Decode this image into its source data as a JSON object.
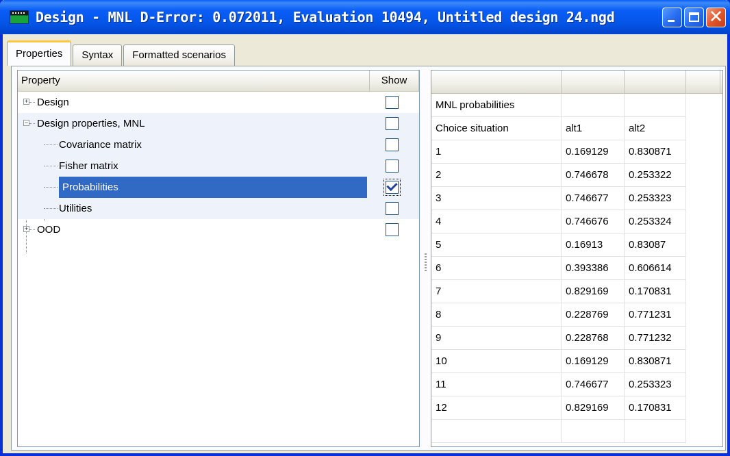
{
  "window": {
    "title": "Design  -  MNL D-Error: 0.072011,  Evaluation 10494,  Untitled design 24.ngd",
    "icon": "app-icon",
    "controls": [
      "minimize-icon",
      "maximize-icon",
      "close-icon"
    ],
    "close_glyph": "✕"
  },
  "tabs": [
    {
      "label": "Properties",
      "active": true
    },
    {
      "label": "Syntax",
      "active": false
    },
    {
      "label": "Formatted scenarios",
      "active": false
    }
  ],
  "tree": {
    "headers": {
      "property": "Property",
      "show": "Show"
    },
    "items": [
      {
        "label": "Design",
        "expander": "+",
        "checked": false
      },
      {
        "label": "Design properties, MNL",
        "expander": "−",
        "checked": false
      },
      {
        "label": "Covariance matrix",
        "checked": false
      },
      {
        "label": "Fisher matrix",
        "checked": false
      },
      {
        "label": "Probabilities",
        "checked": true,
        "selected": true
      },
      {
        "label": "Utilities",
        "checked": false
      },
      {
        "label": "OOD",
        "expander": "+",
        "checked": false
      }
    ]
  },
  "results": {
    "title": "MNL probabilities",
    "columns": [
      "Choice situation",
      "alt1",
      "alt2"
    ],
    "rows": [
      [
        "1",
        "0.169129",
        "0.830871"
      ],
      [
        "2",
        "0.746678",
        "0.253322"
      ],
      [
        "3",
        "0.746677",
        "0.253323"
      ],
      [
        "4",
        "0.746676",
        "0.253324"
      ],
      [
        "5",
        "0.16913",
        "0.83087"
      ],
      [
        "6",
        "0.393386",
        "0.606614"
      ],
      [
        "7",
        "0.829169",
        "0.170831"
      ],
      [
        "8",
        "0.228769",
        "0.771231"
      ],
      [
        "9",
        "0.228768",
        "0.771232"
      ],
      [
        "10",
        "0.169129",
        "0.830871"
      ],
      [
        "11",
        "0.746677",
        "0.253323"
      ],
      [
        "12",
        "0.829169",
        "0.170831"
      ]
    ]
  },
  "colors": {
    "titlebar": "#0a5ef7",
    "selection": "#316ac5",
    "tab_highlight": "#ffc83c",
    "close_button": "#e2582e"
  }
}
